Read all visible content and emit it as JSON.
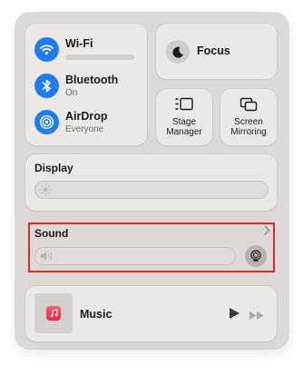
{
  "connectivity": {
    "wifi": {
      "title": "Wi-Fi",
      "icon": "wifi-icon",
      "status_redacted": true
    },
    "bluetooth": {
      "title": "Bluetooth",
      "status": "On",
      "icon": "bluetooth-icon"
    },
    "airdrop": {
      "title": "AirDrop",
      "status": "Everyone",
      "icon": "airdrop-icon"
    }
  },
  "focus": {
    "label": "Focus",
    "icon": "moon-icon"
  },
  "stage_manager": {
    "label_line1": "Stage",
    "label_line2": "Manager",
    "icon": "stage-manager-icon"
  },
  "screen_mirroring": {
    "label_line1": "Screen",
    "label_line2": "Mirroring",
    "icon": "screen-mirroring-icon"
  },
  "display": {
    "title": "Display",
    "icon": "brightness-icon",
    "brightness": 0.0
  },
  "sound": {
    "title": "Sound",
    "icon": "speaker-icon",
    "volume": 0.0,
    "airplay_icon": "airplay-icon"
  },
  "music": {
    "title": "Music",
    "app_icon": "music-app-icon",
    "play_icon": "play-icon",
    "forward_icon": "fast-forward-icon"
  },
  "colors": {
    "panel_bg": "#dcd9d6",
    "module_bg": "#ebe8e6",
    "accent_blue": "#1f7bf2",
    "highlight_red": "#e3262b"
  }
}
